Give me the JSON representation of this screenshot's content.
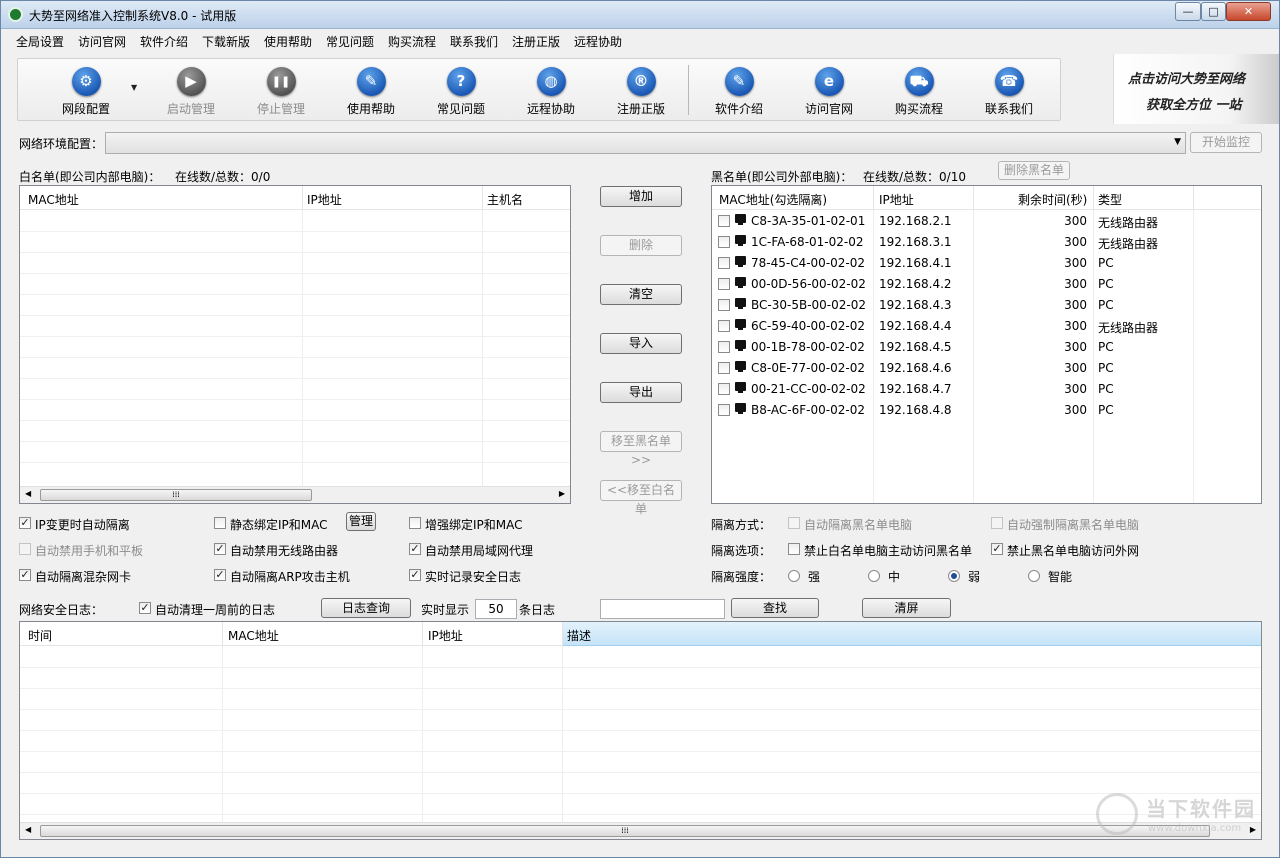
{
  "window": {
    "title": "大势至网络准入控制系统V8.0 - 试用版",
    "min": "—",
    "max": "□",
    "close": "✕"
  },
  "menu": [
    "全局设置",
    "访问官网",
    "软件介绍",
    "下载新版",
    "使用帮助",
    "常见问题",
    "购买流程",
    "联系我们",
    "注册正版",
    "远程协助"
  ],
  "toolbar": [
    {
      "label": "网段配置",
      "icon": "gear-icon",
      "glyph": "⚙",
      "disabled": false
    },
    {
      "label": "启动管理",
      "icon": "play-icon",
      "glyph": "▶",
      "disabled": true
    },
    {
      "label": "停止管理",
      "icon": "pause-icon",
      "glyph": "❚❚",
      "disabled": true
    },
    {
      "label": "使用帮助",
      "icon": "graduation-cap-icon",
      "glyph": "✎",
      "disabled": false
    },
    {
      "label": "常见问题",
      "icon": "question-icon",
      "glyph": "?",
      "disabled": false
    },
    {
      "label": "远程协助",
      "icon": "globe-icon",
      "glyph": "◍",
      "disabled": false
    },
    {
      "label": "注册正版",
      "icon": "registered-icon",
      "glyph": "®",
      "disabled": false
    },
    {
      "label": "软件介绍",
      "icon": "document-edit-icon",
      "glyph": "✎",
      "disabled": false
    },
    {
      "label": "访问官网",
      "icon": "ie-browser-icon",
      "glyph": "e",
      "disabled": false
    },
    {
      "label": "购买流程",
      "icon": "cart-icon",
      "glyph": "⛟",
      "disabled": false
    },
    {
      "label": "联系我们",
      "icon": "phone-icon",
      "glyph": "☎",
      "disabled": false
    }
  ],
  "banner": {
    "line1": "点击访问大势至网络",
    "line2": "获取全方位  一站"
  },
  "network_env": {
    "label": "网络环境配置：",
    "value": "",
    "start_button": "开始监控"
  },
  "whitelist": {
    "title": "白名单(即公司内部电脑)：",
    "online_label": "在线数/总数：0/0",
    "columns": [
      "MAC地址",
      "IP地址",
      "主机名"
    ]
  },
  "middle_buttons": {
    "add": "增加",
    "delete": "删除",
    "clear": "清空",
    "import": "导入",
    "export": "导出",
    "to_black": "移至黑名单>>",
    "to_white": "<<移至白名单"
  },
  "blacklist": {
    "title": "黑名单(即公司外部电脑)：",
    "online_label": "在线数/总数：0/10",
    "delete_button": "删除黑名单",
    "columns": [
      "MAC地址(勾选隔离)",
      "IP地址",
      "剩余时间(秒)",
      "类型"
    ],
    "rows": [
      {
        "mac": "C8-3A-35-01-02-01",
        "ip": "192.168.2.1",
        "time": "300",
        "type": "无线路由器"
      },
      {
        "mac": "1C-FA-68-01-02-02",
        "ip": "192.168.3.1",
        "time": "300",
        "type": "无线路由器"
      },
      {
        "mac": "78-45-C4-00-02-02",
        "ip": "192.168.4.1",
        "time": "300",
        "type": "PC"
      },
      {
        "mac": "00-0D-56-00-02-02",
        "ip": "192.168.4.2",
        "time": "300",
        "type": "PC"
      },
      {
        "mac": "BC-30-5B-00-02-02",
        "ip": "192.168.4.3",
        "time": "300",
        "type": "PC"
      },
      {
        "mac": "6C-59-40-00-02-02",
        "ip": "192.168.4.4",
        "time": "300",
        "type": "无线路由器"
      },
      {
        "mac": "00-1B-78-00-02-02",
        "ip": "192.168.4.5",
        "time": "300",
        "type": "PC"
      },
      {
        "mac": "C8-0E-77-00-02-02",
        "ip": "192.168.4.6",
        "time": "300",
        "type": "PC"
      },
      {
        "mac": "00-21-CC-00-02-02",
        "ip": "192.168.4.7",
        "time": "300",
        "type": "PC"
      },
      {
        "mac": "B8-AC-6F-00-02-02",
        "ip": "192.168.4.8",
        "time": "300",
        "type": "PC"
      }
    ]
  },
  "options": {
    "ip_change_isolate": {
      "label": "IP变更时自动隔离",
      "checked": true
    },
    "static_bind": {
      "label": "静态绑定IP和MAC",
      "checked": false
    },
    "manage_button": "管理",
    "enhance_bind": {
      "label": "增强绑定IP和MAC",
      "checked": false
    },
    "disable_mobile": {
      "label": "自动禁用手机和平板",
      "checked": false,
      "disabled": true
    },
    "disable_wifi_router": {
      "label": "自动禁用无线路由器",
      "checked": true
    },
    "disable_lan_proxy": {
      "label": "自动禁用局域网代理",
      "checked": true
    },
    "isolate_promisc": {
      "label": "自动隔离混杂网卡",
      "checked": true
    },
    "isolate_arp": {
      "label": "自动隔离ARP攻击主机",
      "checked": true
    },
    "realtime_log": {
      "label": "实时记录安全日志",
      "checked": true
    }
  },
  "isolation": {
    "method_label": "隔离方式：",
    "auto_isolate_black": {
      "label": "自动隔离黑名单电脑",
      "checked": false,
      "disabled": true
    },
    "force_isolate_black": {
      "label": "自动强制隔离黑名单电脑",
      "checked": false,
      "disabled": true
    },
    "options_label": "隔离选项：",
    "forbid_white_access": {
      "label": "禁止白名单电脑主动访问黑名单",
      "checked": false
    },
    "forbid_black_internet": {
      "label": "禁止黑名单电脑访问外网",
      "checked": true
    },
    "strength_label": "隔离强度：",
    "strengths": [
      {
        "label": "强",
        "on": false
      },
      {
        "label": "中",
        "on": false
      },
      {
        "label": "弱",
        "on": true
      },
      {
        "label": "智能",
        "on": false
      }
    ]
  },
  "log": {
    "label": "网络安全日志：",
    "auto_clean": {
      "label": "自动清理一周前的日志",
      "checked": true
    },
    "query_button": "日志查询",
    "show_prefix": "实时显示",
    "count": "50",
    "show_suffix": "条日志",
    "search_value": "",
    "find_button": "查找",
    "clear_button": "清屏",
    "columns": [
      "时间",
      "MAC地址",
      "IP地址",
      "描述"
    ]
  },
  "watermark": {
    "name": "当下软件园",
    "url": "www.downxia.com"
  }
}
